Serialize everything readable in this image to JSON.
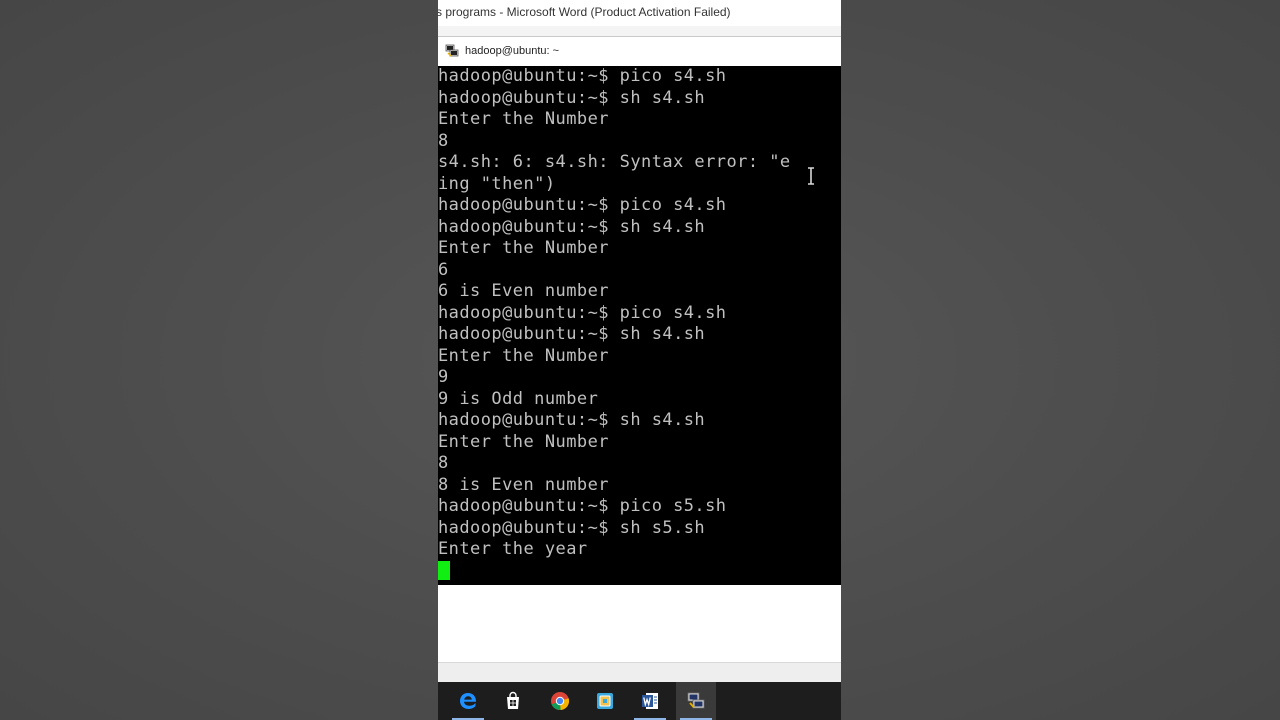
{
  "window": {
    "word_title": "s programs - Microsoft Word (Product Activation Failed)",
    "putty_title": "hadoop@ubuntu: ~"
  },
  "terminal": {
    "lines": [
      "hadoop@ubuntu:~$ pico s4.sh",
      "hadoop@ubuntu:~$ sh s4.sh",
      "Enter the Number",
      "8",
      "s4.sh: 6: s4.sh: Syntax error: \"e",
      "ing \"then\")",
      "hadoop@ubuntu:~$ pico s4.sh",
      "hadoop@ubuntu:~$ sh s4.sh",
      "Enter the Number",
      "6",
      "6 is Even number",
      "hadoop@ubuntu:~$ pico s4.sh",
      "hadoop@ubuntu:~$ sh s4.sh",
      "Enter the Number",
      "9",
      "9 is Odd number",
      "hadoop@ubuntu:~$ sh s4.sh",
      "Enter the Number",
      "8",
      "8 is Even number",
      "hadoop@ubuntu:~$ pico s5.sh",
      "hadoop@ubuntu:~$ sh s5.sh",
      "Enter the year"
    ],
    "cursor_color": "#11ee11",
    "background": "#000000",
    "foreground": "#c0c0c0"
  },
  "taskbar": {
    "items": [
      {
        "name": "edge-icon",
        "active": false
      },
      {
        "name": "store-icon",
        "active": false
      },
      {
        "name": "chrome-icon",
        "active": false
      },
      {
        "name": "vmware-icon",
        "active": false
      },
      {
        "name": "word-icon",
        "active": false
      },
      {
        "name": "putty-icon",
        "active": true
      }
    ]
  },
  "colors": {
    "taskbar": "#1d1d1d",
    "edge": "#1e90ff",
    "word": "#2b579a"
  }
}
